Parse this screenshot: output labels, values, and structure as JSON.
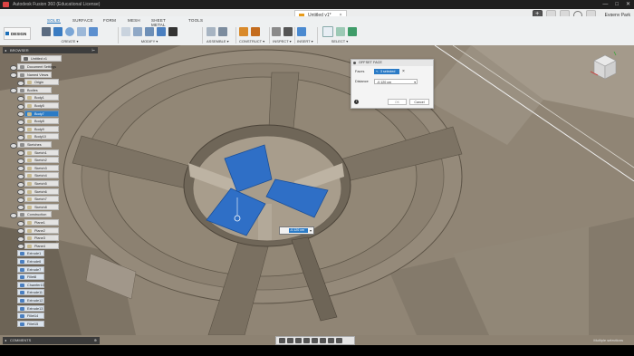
{
  "titlebar": {
    "app_title": "Autodesk Fusion 360 (Educational License)",
    "controls": [
      "—",
      "□",
      "✕"
    ]
  },
  "tabs": {
    "document": "Untitled v1*",
    "user": "Evgeny Park",
    "plus": "+"
  },
  "toolbar": {
    "workspace_tabs": [
      "SOLID",
      "SURFACE",
      "FORM",
      "MESH",
      "SHEET METAL",
      "TOOLS"
    ],
    "active_tab": "SOLID",
    "design_button": "DESIGN",
    "groups": [
      "CREATE ▾",
      "MODIFY ▾",
      "ASSEMBLE ▾",
      "CONSTRUCT ▾",
      "INSPECT ▾",
      "INSERT ▾",
      "SELECT ▾"
    ]
  },
  "browser": {
    "header": "BROWSER",
    "root": "Untitled v1",
    "items": [
      {
        "label": "Document Settings",
        "indent": 1
      },
      {
        "label": "Named Views",
        "indent": 1
      },
      {
        "label": "Origin",
        "indent": 2
      },
      {
        "label": "Bodies",
        "indent": 1
      },
      {
        "label": "Body1",
        "indent": 2
      },
      {
        "label": "Body5",
        "indent": 2
      },
      {
        "label": "Body7",
        "indent": 2,
        "selected": true
      },
      {
        "label": "Body8",
        "indent": 2
      },
      {
        "label": "Body9",
        "indent": 2
      },
      {
        "label": "Body10",
        "indent": 2
      },
      {
        "label": "Sketches",
        "indent": 1
      },
      {
        "label": "Sketch1",
        "indent": 2
      },
      {
        "label": "Sketch2",
        "indent": 2
      },
      {
        "label": "Sketch3",
        "indent": 2
      },
      {
        "label": "Sketch4",
        "indent": 2
      },
      {
        "label": "Sketch5",
        "indent": 2
      },
      {
        "label": "Sketch6",
        "indent": 2
      },
      {
        "label": "Sketch7",
        "indent": 2
      },
      {
        "label": "Sketch8",
        "indent": 2
      },
      {
        "label": "Construction",
        "indent": 1
      },
      {
        "label": "Plane1",
        "indent": 2
      },
      {
        "label": "Plane2",
        "indent": 2
      },
      {
        "label": "Plane3",
        "indent": 2
      },
      {
        "label": "Plane4",
        "indent": 2
      },
      {
        "label": "Extrude1",
        "indent": 0
      },
      {
        "label": "Extrude6",
        "indent": 0
      },
      {
        "label": "Extrude7",
        "indent": 0
      },
      {
        "label": "Fillet8",
        "indent": 0
      },
      {
        "label": "Chamfer10",
        "indent": 0
      },
      {
        "label": "Extrude11",
        "indent": 0
      },
      {
        "label": "Extrude12",
        "indent": 0
      },
      {
        "label": "Extrude13",
        "indent": 0
      },
      {
        "label": "Fillet14",
        "indent": 0
      },
      {
        "label": "Fillet15",
        "indent": 0
      }
    ]
  },
  "dialog": {
    "title": "OFFSET FACE",
    "faces_label": "Faces",
    "faces_value": "3 selected",
    "distance_label": "Distance",
    "distance_value": "-0.120 cm",
    "ok": "OK",
    "cancel": "Cancel"
  },
  "dimension_input": "-0.120 cm",
  "comments": {
    "label": "COMMENTS"
  },
  "status": {
    "multiselect": "Multiple selections"
  },
  "colors": {
    "selection": "#2b7bc6",
    "model": "#8d8272",
    "panel": "#eef0f1"
  }
}
